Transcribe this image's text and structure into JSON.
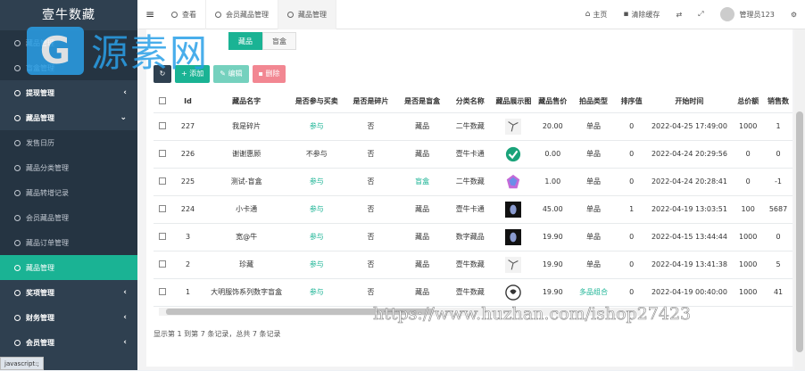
{
  "brand": "壹牛数藏",
  "sidebar": [
    {
      "label": "藏品管理",
      "type": "sub"
    },
    {
      "label": "盲盒管理",
      "type": "sub"
    },
    {
      "label": "提现管理",
      "type": "group",
      "caret": "‹"
    },
    {
      "label": "藏品管理",
      "type": "group",
      "caret": "⌄"
    },
    {
      "label": "发售日历",
      "type": "sub"
    },
    {
      "label": "藏品分类管理",
      "type": "sub"
    },
    {
      "label": "藏品转增记录",
      "type": "sub"
    },
    {
      "label": "会员藏品管理",
      "type": "sub"
    },
    {
      "label": "藏品订单管理",
      "type": "sub"
    },
    {
      "label": "藏品管理",
      "type": "active"
    },
    {
      "label": "奖项管理",
      "type": "group",
      "caret": "‹"
    },
    {
      "label": "财务管理",
      "type": "group",
      "caret": "‹"
    },
    {
      "label": "会员管理",
      "type": "group",
      "caret": "‹"
    }
  ],
  "topbar": {
    "tabs": [
      "查看",
      "会员藏品管理",
      "藏品管理"
    ],
    "home": "主页",
    "clear_cache": "清除缓存",
    "user": "管理员123"
  },
  "filter_tabs": [
    "藏品",
    "盲盒"
  ],
  "toolbar": {
    "add": "添加",
    "edit": "编辑",
    "del": "删除"
  },
  "table": {
    "headers": [
      "Id",
      "藏品名字",
      "是否参与买卖",
      "是否是碎片",
      "是否是盲盒",
      "分类名称",
      "藏品展示图",
      "藏品售价",
      "拍品类型",
      "排序值",
      "开始时间",
      "总价额",
      "销售数"
    ],
    "rows": [
      [
        "227",
        "我是碎片",
        "参与",
        "否",
        "藏品",
        "二牛数藏",
        "img-a",
        "20.00",
        "单品",
        "0",
        "2022-04-25 17:49:00",
        "1000",
        "1"
      ],
      [
        "226",
        "谢谢惠顾",
        "不参与",
        "否",
        "藏品",
        "壹牛卡通",
        "img-check",
        "0.00",
        "单品",
        "0",
        "2022-04-24 20:29:56",
        "0",
        "0"
      ],
      [
        "225",
        "测试-盲盒",
        "参与",
        "否",
        "盲盒",
        "二牛数藏",
        "img-gem",
        "1.00",
        "单品",
        "0",
        "2022-04-24 20:28:41",
        "0",
        "-1"
      ],
      [
        "224",
        "小卡通",
        "参与",
        "否",
        "藏品",
        "壹牛卡通",
        "img-dark",
        "45.00",
        "单品",
        "1",
        "2022-04-19 13:03:51",
        "100",
        "5687"
      ],
      [
        "3",
        "宽@牛",
        "参与",
        "否",
        "藏品",
        "数字藏品",
        "img-dark",
        "19.90",
        "单品",
        "0",
        "2022-04-15 13:44:44",
        "1000",
        "0"
      ],
      [
        "2",
        "珍藏",
        "参与",
        "否",
        "藏品",
        "壹牛数藏",
        "img-a",
        "19.90",
        "单品",
        "0",
        "2022-04-19 13:41:38",
        "1000",
        "5"
      ],
      [
        "1",
        "大明服饰系列数字盲盒",
        "参与",
        "否",
        "藏品",
        "壹牛数藏",
        "img-round",
        "19.90",
        "多品组合",
        "0",
        "2022-04-19 00:40:00",
        "1000",
        "41"
      ]
    ]
  },
  "footer": "显示第 1 到第 7 条记录，总共 7 条记录",
  "status": "javascript:;",
  "watermark": {
    "logo": "G",
    "text": "源素网",
    "url": "https://www.huzhan.com/ishop27423"
  }
}
